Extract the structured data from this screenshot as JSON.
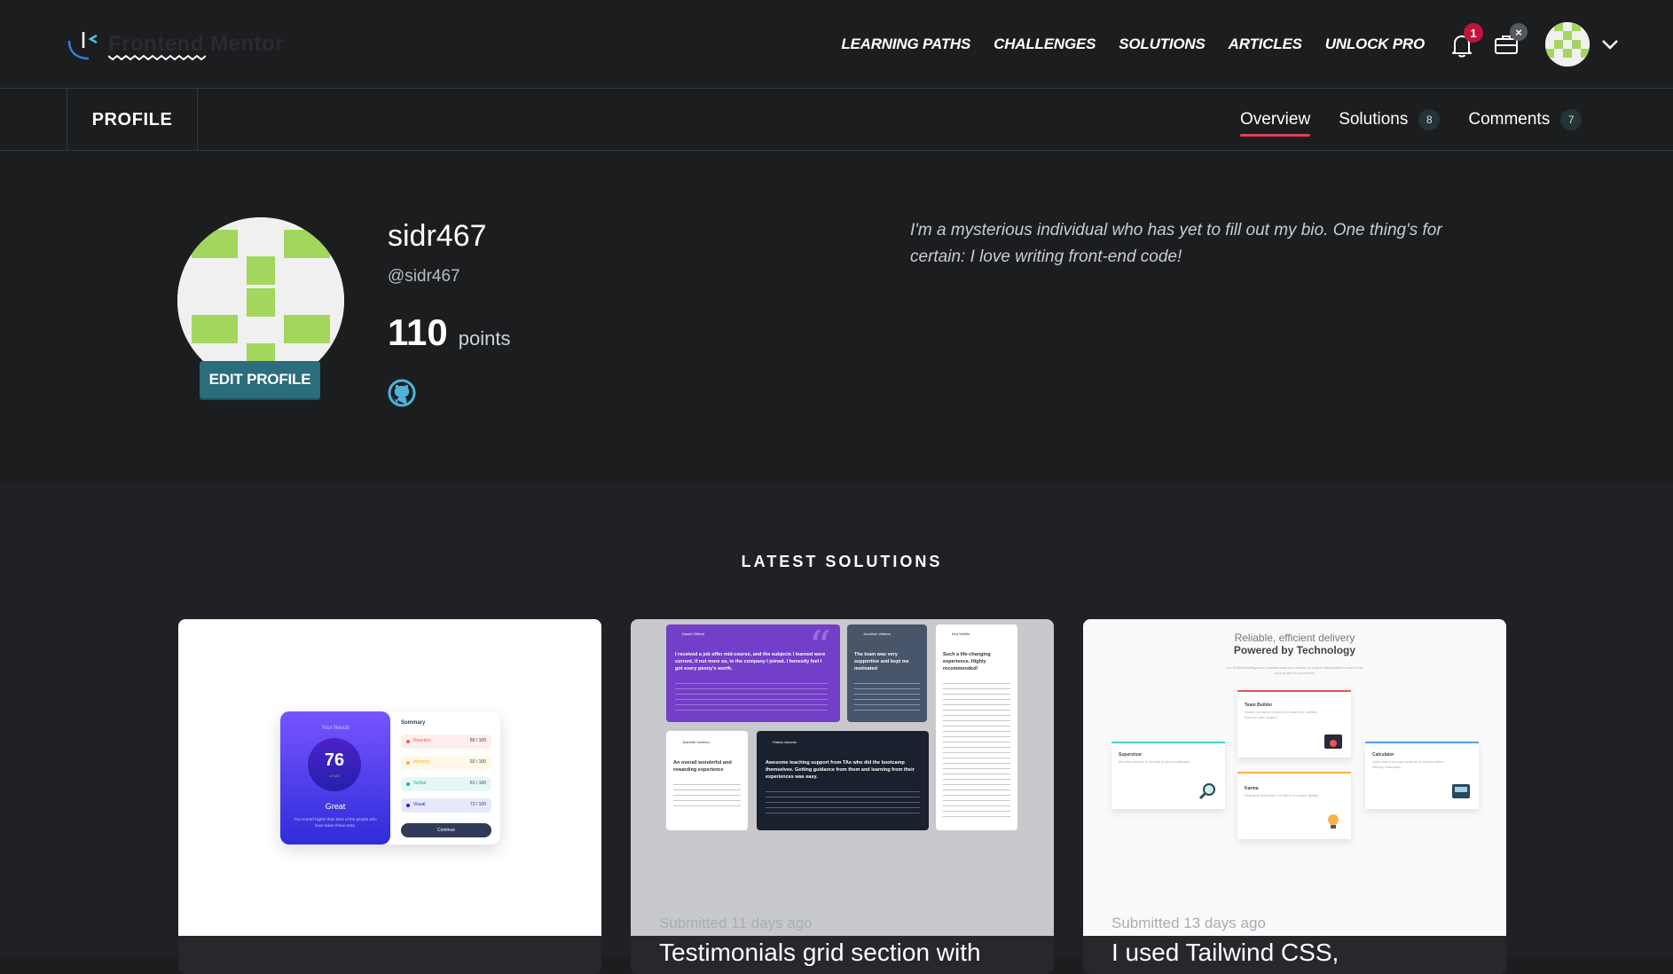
{
  "logo": {
    "text": "Frontend Mentor"
  },
  "nav": {
    "links": [
      "LEARNING PATHS",
      "CHALLENGES",
      "SOLUTIONS",
      "ARTICLES",
      "UNLOCK PRO"
    ],
    "notifications_count": "1",
    "briefcase_badge": "×"
  },
  "subnav": {
    "section_title": "PROFILE",
    "tabs": [
      {
        "label": "Overview",
        "count": ""
      },
      {
        "label": "Solutions",
        "count": "8"
      },
      {
        "label": "Comments",
        "count": "7"
      }
    ]
  },
  "profile": {
    "name": "sidr467",
    "handle": "@sidr467",
    "points": "110",
    "points_label": "points",
    "edit_label": "EDIT PROFILE",
    "bio": "I'm a mysterious individual who has yet to fill out my bio. One thing's for certain: I love writing front-end code!"
  },
  "latest": {
    "title": "LATEST SOLUTIONS",
    "cards": [
      {
        "date": "",
        "title": "",
        "thumb": {
          "result_label": "Your Result",
          "score": "76",
          "score_of": "of 100",
          "grade": "Great",
          "grade_text": "You scored higher than 65% of the people who have taken these tests.",
          "summary_title": "Summary",
          "rows": [
            {
              "name": "Reaction",
              "value": "80",
              "total": "/ 100",
              "color": "#ff5757"
            },
            {
              "name": "Memory",
              "value": "92",
              "total": "/ 100",
              "color": "#ffb01f"
            },
            {
              "name": "Verbal",
              "value": "61",
              "total": "/ 100",
              "color": "#00bb8f"
            },
            {
              "name": "Visual",
              "value": "72",
              "total": "/ 100",
              "color": "#1125d4"
            }
          ],
          "button": "Continue"
        }
      },
      {
        "date": "Submitted 11 days ago",
        "title": "Testimonials grid section with",
        "thumb": {
          "people": [
            "Daniel Clifford",
            "Jonathan Walters",
            "Kira Whittle",
            "Jeanette Harmon",
            "Patrick Abrams"
          ],
          "headlines": [
            "I received a job offer mid-course, and the subjects I learned were current, if not more so, in the company I joined. I honestly feel I got every penny's worth.",
            "The team was very supportive and kept me motivated",
            "Such a life-changing experience. Highly recommended!",
            "An overall wonderful and rewarding experience",
            "Awesome teaching support from TAs who did the bootcamp themselves. Getting guidance from them and learning from their experiences was easy."
          ]
        }
      },
      {
        "date": "Submitted 13 days ago",
        "title": "I used Tailwind CSS,",
        "thumb": {
          "kicker": "Reliable, efficient delivery",
          "heading": "Powered by Technology",
          "intro": "Our Artificial Intelligence powered tools use millions of project data points to ensure that your project is successful",
          "features": [
            {
              "name": "Supervisor",
              "text": "Monitors activity to identify project roadblocks",
              "color": "#44d3d2"
            },
            {
              "name": "Team Builder",
              "text": "Scans our talent network to create the optimal team for your project",
              "color": "#ea5454"
            },
            {
              "name": "Karma",
              "text": "Regularly evaluates our talent to ensure quality",
              "color": "#fcaf4a"
            },
            {
              "name": "Calculator",
              "text": "Uses data from past projects to provide better delivery estimates",
              "color": "#549ef2"
            }
          ]
        }
      }
    ]
  },
  "colors": {
    "accent": "#e0405c",
    "edit_button": "#2b6c7d",
    "avatar_green": "#a3d65c"
  }
}
